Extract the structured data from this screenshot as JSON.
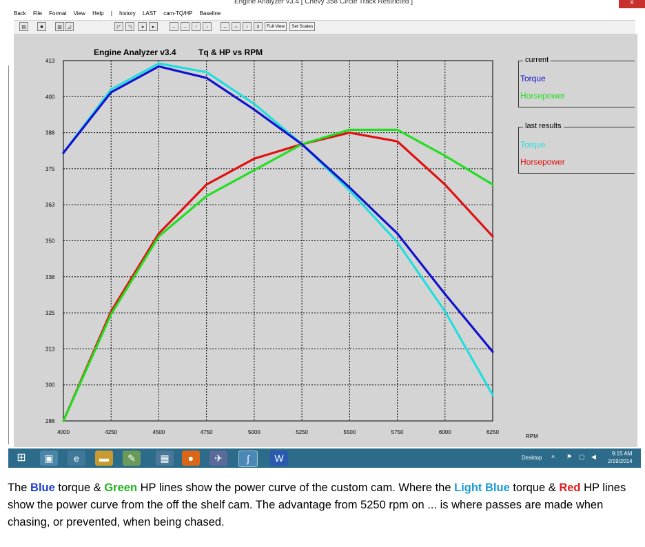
{
  "window": {
    "title": "Engine Analyzer v3.4 [ Chevy 358 Circle Track Restricted ]",
    "close_label": "x"
  },
  "menu": {
    "items": [
      "Back",
      "File",
      "Format",
      "View",
      "Help",
      "|",
      "history",
      "LAST",
      "cam-TQ/HP",
      "Baseline"
    ]
  },
  "toolbar": {
    "full_view_label": "Full View",
    "set_scales_label": "Set Scales"
  },
  "header": {
    "app_title": "Engine Analyzer v3.4",
    "chart_heading": "Tq & HP vs RPM"
  },
  "legend": {
    "current": {
      "caption": "current",
      "torque": "Torque",
      "horsepower": "Horsepower"
    },
    "last": {
      "caption": "last results",
      "torque": "Torque",
      "horsepower": "Horsepower"
    }
  },
  "colors": {
    "current_torque": "#1010d0",
    "current_hp": "#22dd22",
    "last_torque": "#22dddd",
    "last_hp": "#e01010",
    "background": "#d4d4d4"
  },
  "chart_data": {
    "type": "line",
    "title": "Tq & HP vs RPM",
    "xlabel": "RPM",
    "ylabel": "",
    "x": [
      4000,
      4250,
      4500,
      4750,
      5000,
      5250,
      5500,
      5750,
      6000,
      6250
    ],
    "ylim": [
      288,
      413
    ],
    "y_ticks": [
      "413",
      "400",
      "388",
      "375",
      "363",
      "350",
      "338",
      "325",
      "313",
      "300",
      "288"
    ],
    "grid": true,
    "series": [
      {
        "name": "Torque",
        "group": "current",
        "values": [
          381,
          402,
          411,
          407,
          396,
          384,
          369,
          353,
          332,
          312
        ]
      },
      {
        "name": "Horsepower",
        "group": "current",
        "values": [
          288,
          325,
          352,
          366,
          375,
          384,
          389,
          389,
          380,
          370
        ]
      },
      {
        "name": "Torque",
        "group": "last results",
        "values": [
          381,
          403,
          412,
          409,
          398,
          384,
          368,
          350,
          326,
          297
        ]
      },
      {
        "name": "Horsepower",
        "group": "last results",
        "values": [
          288,
          326,
          353,
          370,
          379,
          384,
          388,
          385,
          370,
          352
        ]
      }
    ]
  },
  "taskbar": {
    "desktop_label": "Desktop",
    "time": "9:15 AM",
    "date": "2/19/2014"
  },
  "caption": {
    "p1": "The ",
    "blue": "Blue",
    "p2": " torque & ",
    "green": "Green",
    "p3": " HP lines show the power curve of the custom cam. Where the ",
    "lblue": "Light Blue",
    "p4": " torque & ",
    "red": "Red",
    "p5": " HP lines show the power curve from the off the shelf cam.  The advantage from 5250 rpm on ... is where passes are made when chasing, or prevented, when being chased."
  }
}
